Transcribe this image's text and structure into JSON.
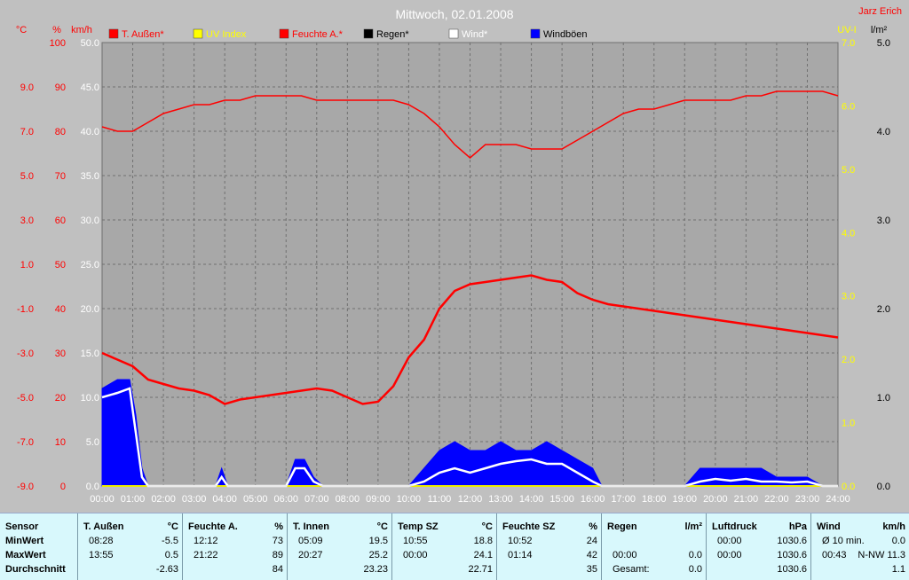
{
  "title": "Mittwoch, 02.01.2008",
  "author": "Jarz Erich",
  "colors": {
    "background": "#c0c0c0",
    "plot": "#a8a8a8",
    "grid": "#707070",
    "red": "#ff0000",
    "blue": "#0000ff",
    "white": "#ffffff",
    "yellow": "#ffff00",
    "table": "#d8f8fc"
  },
  "legend": [
    {
      "label": "T. Außen*",
      "color": "#ff0000",
      "text_color": "#ff0000"
    },
    {
      "label": "UV Index",
      "color": "#ffff00",
      "text_color": "#ffff00"
    },
    {
      "label": "Feuchte A.*",
      "color": "#ff0000",
      "text_color": "#ff0000"
    },
    {
      "label": "Regen*",
      "color": "#000000",
      "text_color": "#000000"
    },
    {
      "label": "Wind*",
      "color": "#ffffff",
      "text_color": "#ffffff"
    },
    {
      "label": "Windböen",
      "color": "#0000ff",
      "text_color": "#000000"
    }
  ],
  "axes": {
    "temp": {
      "unit": "°C",
      "ticks": [
        "9.0",
        "7.0",
        "5.0",
        "3.0",
        "1.0",
        "-1.0",
        "-3.0",
        "-5.0",
        "-7.0",
        "-9.0"
      ]
    },
    "humidity": {
      "unit": "%",
      "ticks": [
        "100",
        "90",
        "80",
        "70",
        "60",
        "50",
        "40",
        "30",
        "20",
        "10",
        "0"
      ]
    },
    "wind": {
      "unit": "km/h",
      "ticks": [
        "50.0",
        "45.0",
        "40.0",
        "35.0",
        "30.0",
        "25.0",
        "20.0",
        "15.0",
        "10.0",
        "5.0",
        "0.0"
      ]
    },
    "uv": {
      "unit": "UV-I",
      "ticks": [
        "7.0",
        "6.0",
        "5.0",
        "4.0",
        "3.0",
        "2.0",
        "1.0",
        "0.0"
      ]
    },
    "rain": {
      "unit": "l/m²",
      "ticks": [
        "5.0",
        "4.0",
        "3.0",
        "2.0",
        "1.0",
        "0.0"
      ]
    },
    "x_ticks": [
      "00:00",
      "01:00",
      "02:00",
      "03:00",
      "04:00",
      "05:00",
      "06:00",
      "07:00",
      "08:00",
      "09:00",
      "10:00",
      "11:00",
      "12:00",
      "13:00",
      "14:00",
      "15:00",
      "16:00",
      "17:00",
      "18:00",
      "19:00",
      "20:00",
      "21:00",
      "22:00",
      "23:00",
      "24:00"
    ]
  },
  "chart_data": {
    "type": "line",
    "title": "Mittwoch, 02.01.2008",
    "x_range": [
      "00:00",
      "24:00"
    ],
    "y_ranges": {
      "temp_c": [
        -9,
        11
      ],
      "humidity_pct": [
        0,
        100
      ],
      "wind_kmh": [
        0,
        50
      ],
      "uv": [
        0,
        7
      ],
      "rain_lm2": [
        0,
        5
      ]
    },
    "grid": true,
    "series": [
      {
        "name": "Feuchte A.*",
        "axis": "humidity_pct",
        "x": [
          0,
          0.5,
          1,
          1.5,
          2,
          2.5,
          3,
          3.5,
          4,
          4.5,
          5,
          5.5,
          6,
          6.5,
          7,
          7.5,
          8,
          8.5,
          9,
          9.5,
          10,
          10.5,
          11,
          11.5,
          12,
          12.5,
          13,
          13.5,
          14,
          14.5,
          15,
          15.5,
          16,
          16.5,
          17,
          17.5,
          18,
          18.5,
          19,
          19.5,
          20,
          20.5,
          21,
          21.5,
          22,
          22.5,
          23,
          23.5,
          24
        ],
        "y": [
          81,
          80,
          80,
          82,
          84,
          85,
          86,
          86,
          87,
          87,
          88,
          88,
          88,
          88,
          87,
          87,
          87,
          87,
          87,
          87,
          86,
          84,
          81,
          77,
          74,
          77,
          77,
          77,
          76,
          76,
          76,
          78,
          80,
          82,
          84,
          85,
          85,
          86,
          87,
          87,
          87,
          87,
          88,
          88,
          89,
          89,
          89,
          89,
          88
        ]
      },
      {
        "name": "T. Außen*",
        "axis": "temp_c",
        "x": [
          0,
          0.5,
          1,
          1.5,
          2,
          2.5,
          3,
          3.5,
          4,
          4.5,
          5,
          5.5,
          6,
          6.5,
          7,
          7.5,
          8,
          8.5,
          9,
          9.5,
          10,
          10.5,
          11,
          11.5,
          12,
          12.5,
          13,
          13.5,
          14,
          14.5,
          15,
          15.5,
          16,
          16.5,
          17,
          17.5,
          18,
          18.5,
          19,
          19.5,
          20,
          20.5,
          21,
          21.5,
          22,
          22.5,
          23,
          23.5,
          24
        ],
        "y": [
          -3.0,
          -3.3,
          -3.6,
          -4.2,
          -4.4,
          -4.6,
          -4.7,
          -4.9,
          -5.3,
          -5.1,
          -5.0,
          -4.9,
          -4.8,
          -4.7,
          -4.6,
          -4.7,
          -5.0,
          -5.3,
          -5.2,
          -4.5,
          -3.2,
          -2.4,
          -1.0,
          -0.2,
          0.1,
          0.2,
          0.3,
          0.4,
          0.5,
          0.3,
          0.2,
          -0.3,
          -0.6,
          -0.8,
          -0.9,
          -1.0,
          -1.1,
          -1.2,
          -1.3,
          -1.4,
          -1.5,
          -1.6,
          -1.7,
          -1.8,
          -1.9,
          -2.0,
          -2.1,
          -2.2,
          -2.3
        ]
      },
      {
        "name": "Windböen",
        "axis": "wind_kmh",
        "type": "area",
        "x": [
          0,
          0.5,
          0.9,
          1.1,
          1.3,
          1.5,
          3.7,
          3.9,
          4.1,
          6.0,
          6.3,
          6.6,
          6.9,
          7.2,
          10.0,
          10.5,
          11.0,
          11.5,
          12.0,
          12.5,
          13.0,
          13.5,
          14.0,
          14.5,
          15.0,
          15.5,
          16.0,
          16.3,
          19.0,
          19.5,
          20.0,
          20.5,
          21.0,
          21.5,
          22.0,
          22.5,
          23.0,
          23.5,
          24.0
        ],
        "y": [
          11,
          12,
          12,
          8,
          2,
          0,
          0,
          2,
          0,
          0,
          3,
          3,
          1,
          0,
          0,
          2,
          4,
          5,
          4,
          4,
          5,
          4,
          4,
          5,
          4,
          3,
          2,
          0,
          0,
          2,
          2,
          2,
          2,
          2,
          1,
          1,
          1,
          0,
          0
        ]
      },
      {
        "name": "Wind*",
        "axis": "wind_kmh",
        "x": [
          0,
          0.5,
          0.9,
          1.1,
          1.3,
          1.5,
          3.7,
          3.9,
          4.1,
          6.0,
          6.3,
          6.6,
          6.9,
          7.2,
          10.0,
          10.5,
          11.0,
          11.5,
          12.0,
          12.5,
          13.0,
          13.5,
          14.0,
          14.5,
          15.0,
          15.5,
          16.0,
          16.3,
          19.0,
          19.5,
          20.0,
          20.5,
          21.0,
          21.5,
          22.0,
          22.5,
          23.0,
          23.5,
          24.0
        ],
        "y": [
          10,
          10.5,
          11,
          6,
          1,
          0,
          0,
          1,
          0,
          0,
          2,
          2,
          0.5,
          0,
          0,
          0.5,
          1.5,
          2,
          1.5,
          2,
          2.5,
          2.8,
          3,
          2.5,
          2.5,
          1.5,
          0.5,
          0,
          0,
          0.5,
          0.8,
          0.6,
          0.8,
          0.5,
          0.5,
          0.4,
          0.5,
          0,
          0
        ]
      },
      {
        "name": "UV Index",
        "axis": "uv",
        "x": [
          0,
          24
        ],
        "y": [
          0,
          0
        ]
      },
      {
        "name": "Regen*",
        "axis": "rain_lm2",
        "x": [
          0,
          24
        ],
        "y": [
          0,
          0
        ]
      }
    ]
  },
  "table": [
    {
      "header": [
        "Sensor",
        ""
      ],
      "rows": [
        [
          "MinWert",
          ""
        ],
        [
          "MaxWert",
          ""
        ],
        [
          "Durchschnitt",
          ""
        ]
      ]
    },
    {
      "header": [
        "T. Außen",
        "°C"
      ],
      "rows": [
        [
          "08:28",
          "-5.5"
        ],
        [
          "13:55",
          "0.5"
        ],
        [
          "",
          "-2.63"
        ]
      ]
    },
    {
      "header": [
        "Feuchte A.",
        "%"
      ],
      "rows": [
        [
          "12:12",
          "73"
        ],
        [
          "21:22",
          "89"
        ],
        [
          "",
          "84"
        ]
      ]
    },
    {
      "header": [
        "T. Innen",
        "°C"
      ],
      "rows": [
        [
          "05:09",
          "19.5"
        ],
        [
          "20:27",
          "25.2"
        ],
        [
          "",
          "23.23"
        ]
      ]
    },
    {
      "header": [
        "Temp SZ",
        "°C"
      ],
      "rows": [
        [
          "10:55",
          "18.8"
        ],
        [
          "00:00",
          "24.1"
        ],
        [
          "",
          "22.71"
        ]
      ]
    },
    {
      "header": [
        "Feuchte SZ",
        "%"
      ],
      "rows": [
        [
          "10:52",
          "24"
        ],
        [
          "01:14",
          "42"
        ],
        [
          "",
          "35"
        ]
      ]
    },
    {
      "header": [
        "Regen",
        "l/m²"
      ],
      "rows": [
        [
          "",
          ""
        ],
        [
          "00:00",
          "0.0"
        ],
        [
          "Gesamt:",
          "0.0"
        ]
      ]
    },
    {
      "header": [
        "Luftdruck",
        "hPa"
      ],
      "rows": [
        [
          "00:00",
          "1030.6"
        ],
        [
          "00:00",
          "1030.6"
        ],
        [
          "",
          "1030.6"
        ]
      ]
    },
    {
      "header": [
        "Wind",
        "km/h"
      ],
      "rows": [
        [
          "Ø 10 min.",
          "0.0"
        ],
        [
          "00:43",
          "N-NW 11.3"
        ],
        [
          "",
          "1.1"
        ]
      ]
    }
  ]
}
